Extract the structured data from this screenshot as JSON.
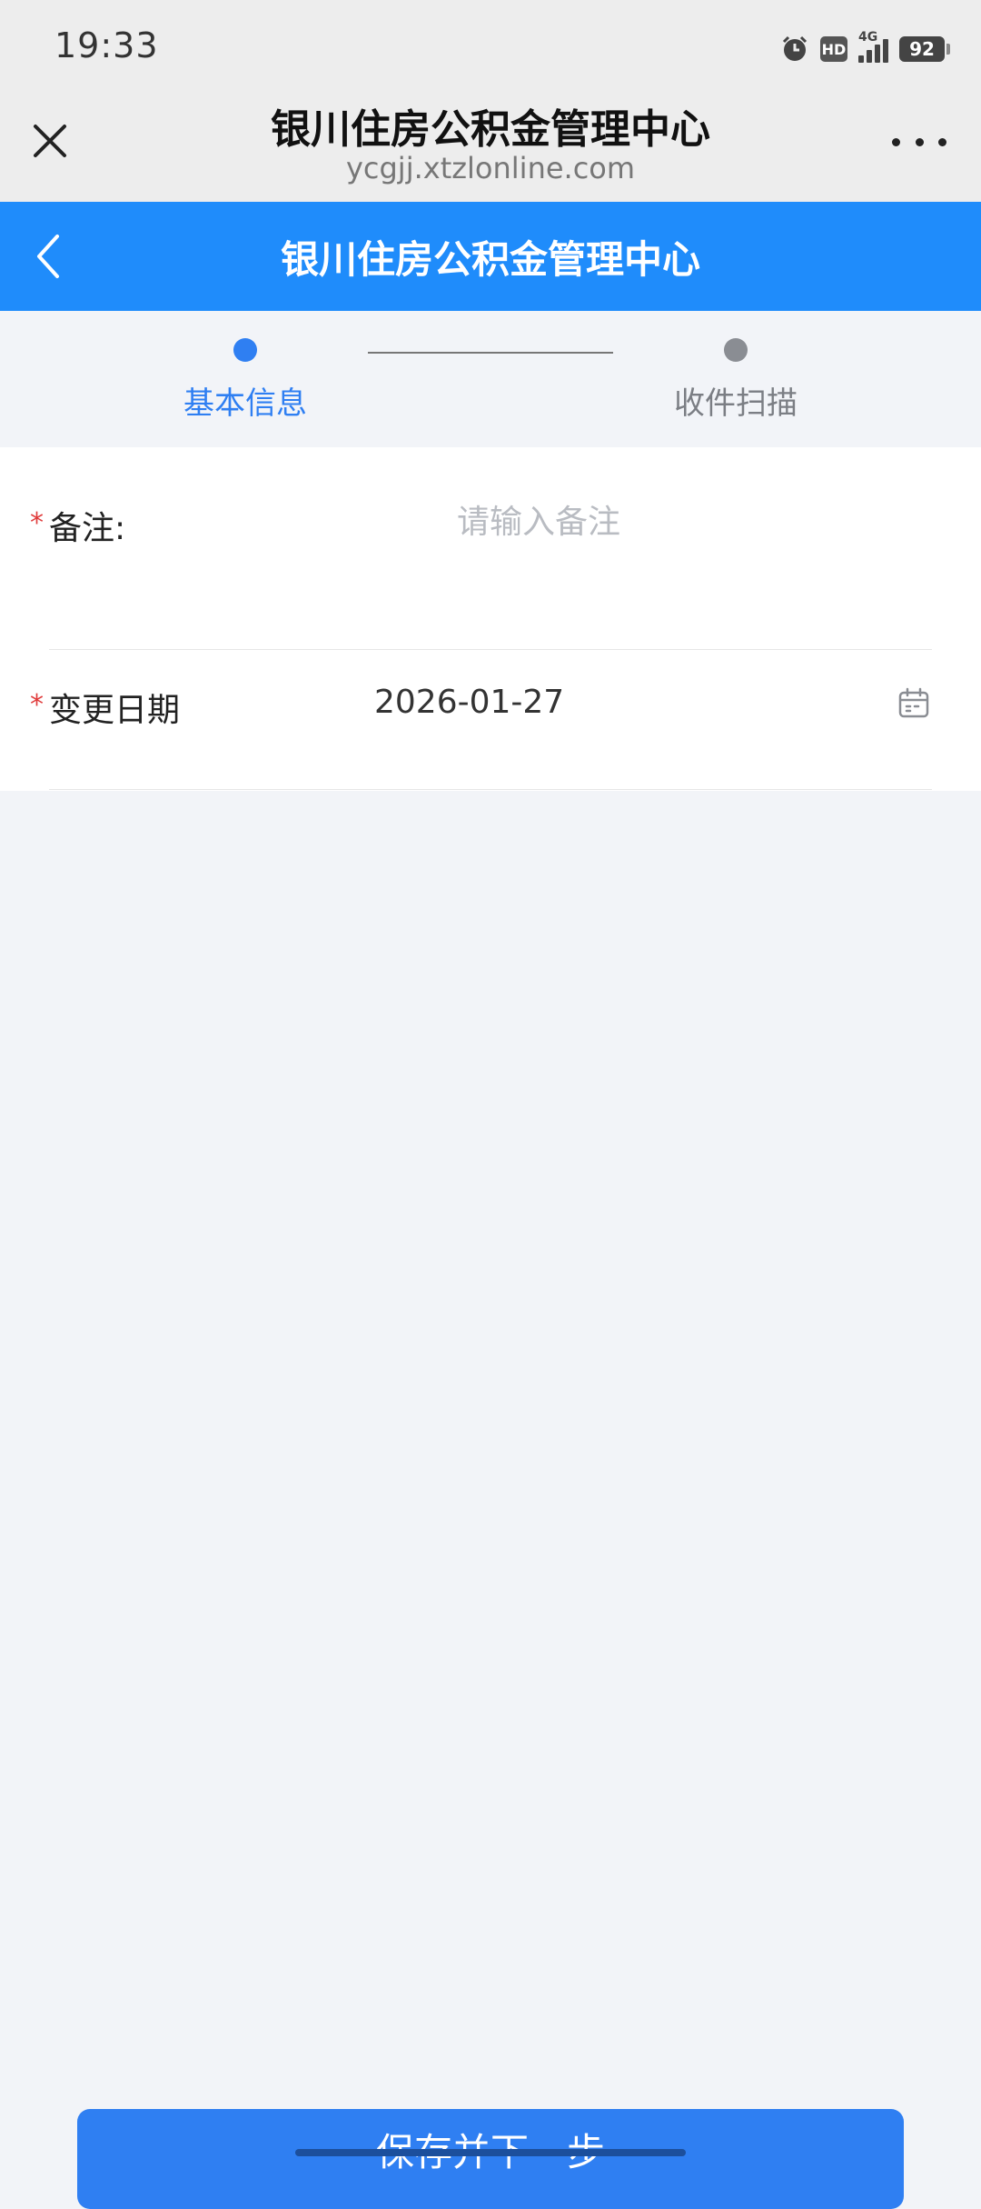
{
  "status_bar": {
    "time": "19:33",
    "hd": "HD",
    "network": "4G",
    "battery": "92"
  },
  "browser": {
    "title": "银川住房公积金管理中心",
    "url": "ycgjj.xtzlonline.com"
  },
  "app_header": {
    "title": "银川住房公积金管理中心"
  },
  "steps": [
    {
      "label": "基本信息",
      "active": true
    },
    {
      "label": "收件扫描",
      "active": false
    }
  ],
  "form": {
    "remark": {
      "required_mark": "*",
      "label": "备注:",
      "value": "",
      "placeholder": "请输入备注"
    },
    "change_date": {
      "required_mark": "*",
      "label": "变更日期",
      "value": "2026-01-27"
    }
  },
  "actions": {
    "save_next_label": "保存并下一步"
  },
  "colors": {
    "primary": "#1f8cfb",
    "step_active": "#2f7ff2",
    "step_inactive": "#8a8d93",
    "required": "#e03b3b"
  }
}
